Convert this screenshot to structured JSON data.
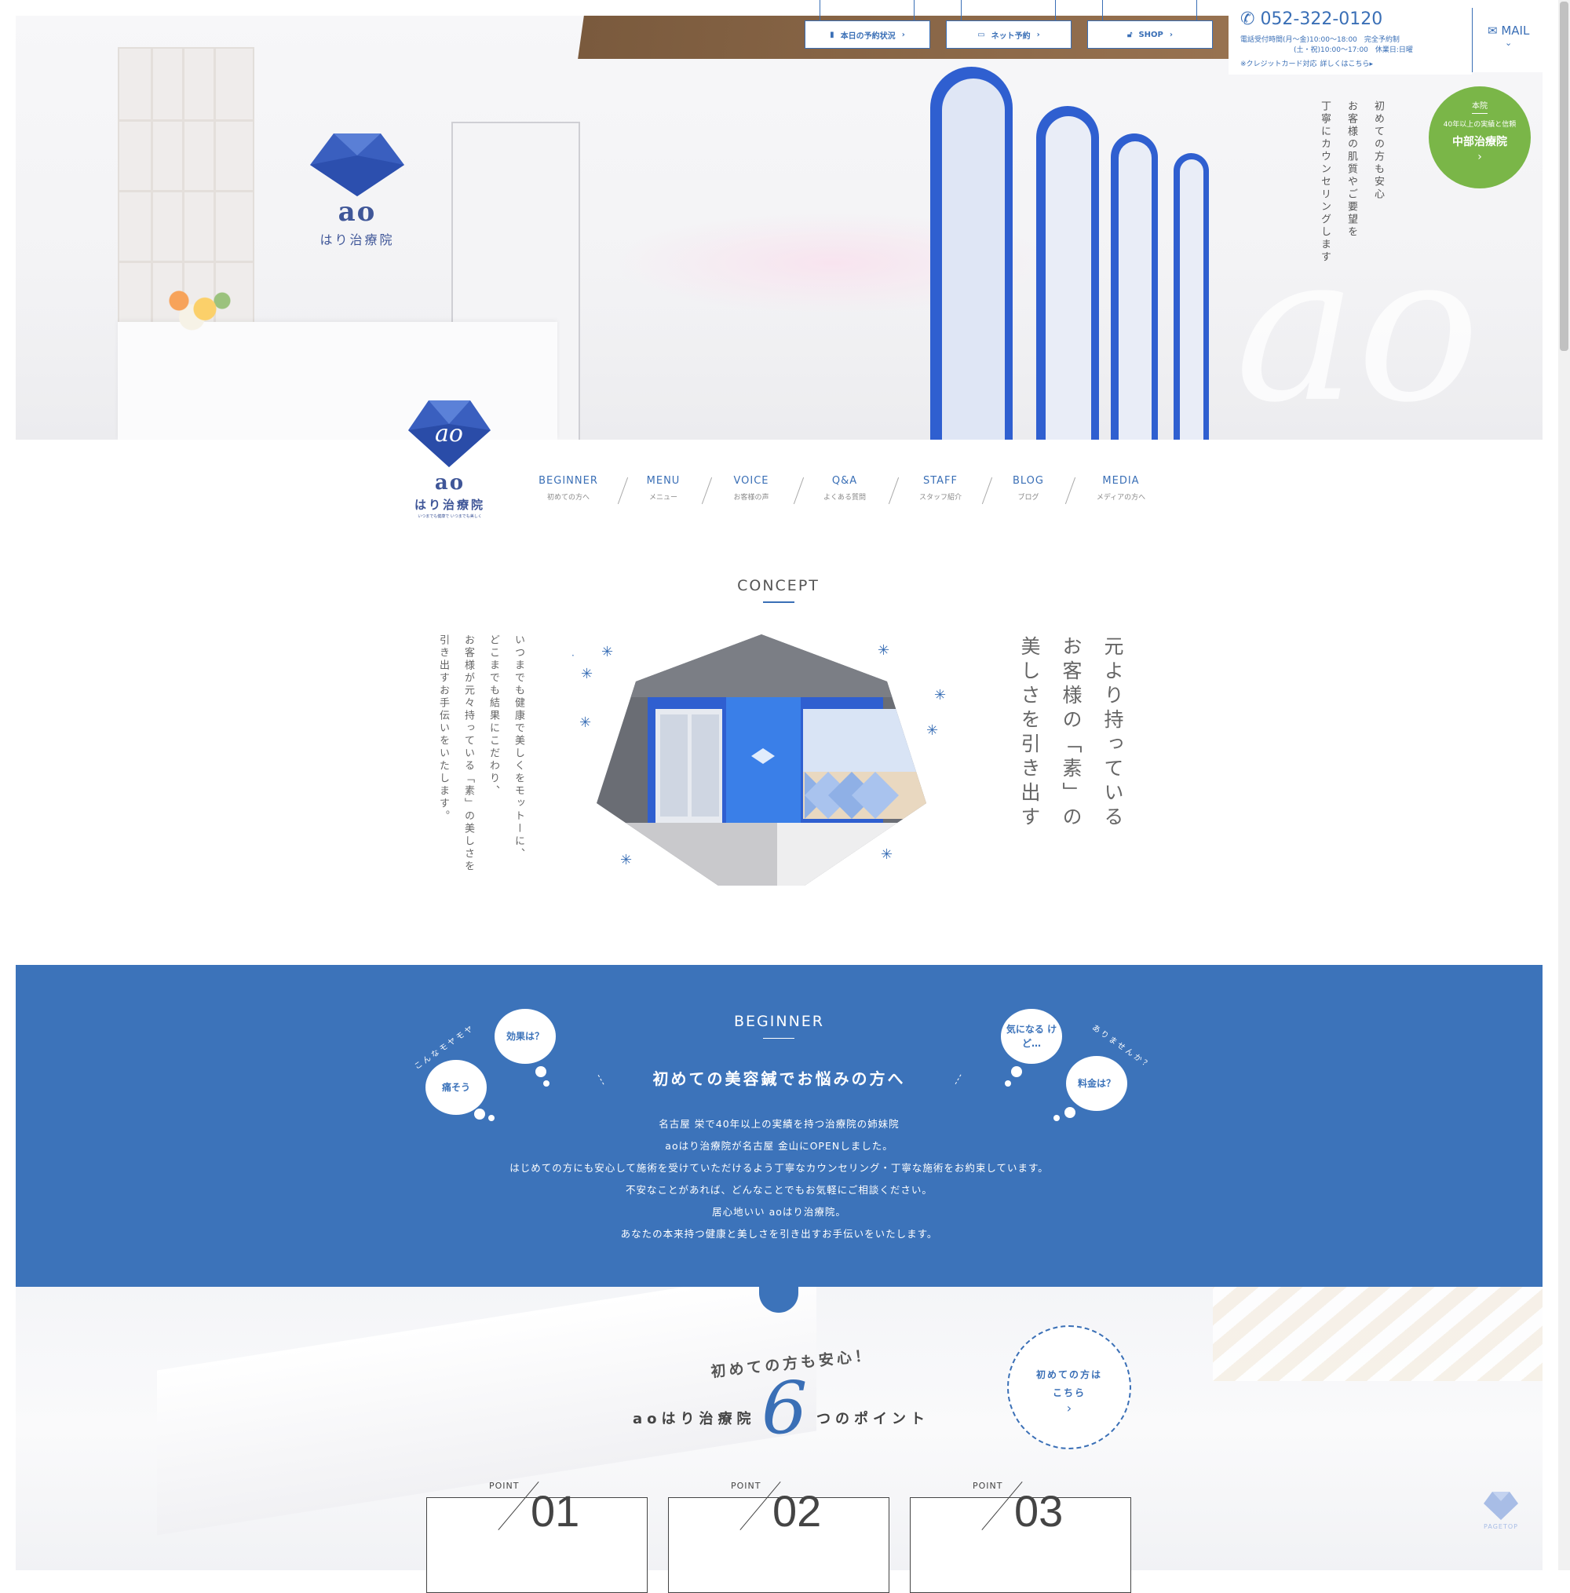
{
  "colors": {
    "brand_blue": "#3c73ba",
    "accent_blue": "#3a6fb6",
    "green": "#7ab648",
    "white": "#ffffff"
  },
  "topbar": {
    "buttons": [
      {
        "label": "本日の予約状況",
        "icon": "book-icon"
      },
      {
        "label": "ネット予約",
        "icon": "laptop-icon"
      },
      {
        "label": "SHOP",
        "icon": "lock-icon"
      }
    ],
    "phone": "052-322-0120",
    "hours_line1": "電話受付時間(月〜金)10:00〜18:00　完全予約制",
    "hours_line2": "(土・祝)10:00〜17:00　休業日:日曜",
    "credit": "※クレジットカード対応",
    "credit_link": "詳しくはこちら▸",
    "mail": "MAIL"
  },
  "hero": {
    "copy_lines": [
      "初めての方も安心",
      "お客様の肌質やご要望を",
      "丁寧にカウンセリングします"
    ],
    "logo_text": "ao",
    "logo_sub": "はり治療院"
  },
  "honin": {
    "tag": "本院",
    "sub": "40年以上の実績と信頼",
    "name": "中部治療院",
    "arrow": "›"
  },
  "logo": {
    "name": "ao",
    "sub": "はり治療院",
    "tagline": "いつまでも健康で いつまでも美しく",
    "script": "ao"
  },
  "nav": [
    {
      "en": "BEGINNER",
      "jp": "初めての方へ"
    },
    {
      "en": "MENU",
      "jp": "メニュー"
    },
    {
      "en": "VOICE",
      "jp": "お客様の声"
    },
    {
      "en": "Q&A",
      "jp": "よくある質問"
    },
    {
      "en": "STAFF",
      "jp": "スタッフ紹介"
    },
    {
      "en": "BLOG",
      "jp": "ブログ"
    },
    {
      "en": "MEDIA",
      "jp": "メディアの方へ"
    }
  ],
  "concept": {
    "title": "CONCEPT",
    "headline": [
      "元より持っている",
      "お客様の「素」の",
      "美しさを引き出す"
    ],
    "body": [
      "いつまでも健康で美しくをモットーに、",
      "どこまでも結果にこだわり、",
      "お客様が元々持っている「素」の美しさを",
      "引き出すお手伝いをいたします。"
    ]
  },
  "beginner": {
    "title": "BEGINNER",
    "heading": "初めての美容鍼でお悩みの方へ",
    "body": [
      "名古屋 栄で40年以上の実績を持つ治療院の姉妹院",
      "aoはり治療院が名古屋 金山にOPENしました。",
      "はじめての方にも安心して施術を受けていただけるよう丁寧なカウンセリング・丁寧な施術をお約束しています。",
      "不安なことがあれば、どんなことでもお気軽にご相談ください。",
      "居心地いい aoはり治療院。",
      "あなたの本来持つ健康と美しさを引き出すお手伝いをいたします。"
    ],
    "left_arc": "こんなモヤモヤ",
    "right_arc": "ありませんか？",
    "clouds": [
      "効果は？",
      "痛そう",
      "気になる けど…",
      "料金は？"
    ]
  },
  "points": {
    "top": "初めての方も安心！",
    "a": "aoはり治療院",
    "num": "6",
    "b": "つのポイント",
    "circle_line1": "初めての方は",
    "circle_line2": "こちら",
    "circle_arrow": "›",
    "label": "POINT",
    "cards": [
      "01",
      "02",
      "03"
    ]
  },
  "pagetop": "PAGETOP"
}
